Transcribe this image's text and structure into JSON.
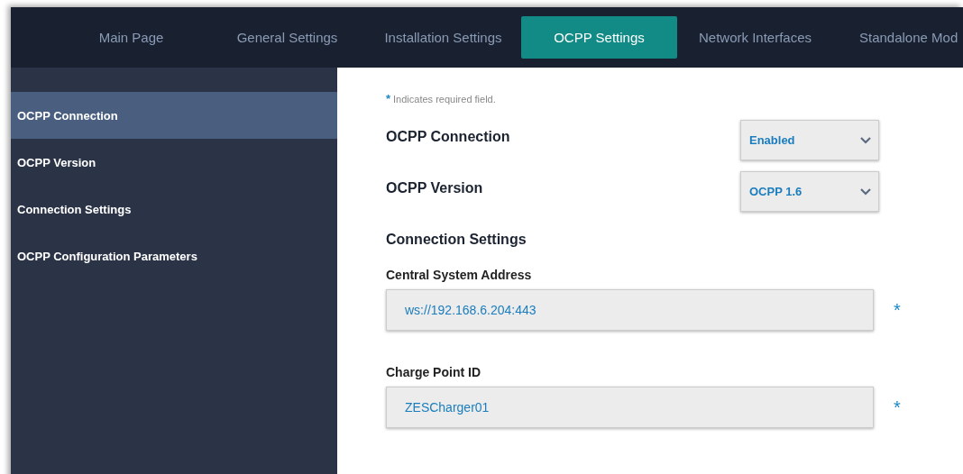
{
  "nav": {
    "tabs": [
      {
        "label": "Main Page",
        "selected": false
      },
      {
        "label": "General Settings",
        "selected": false
      },
      {
        "label": "Installation Settings",
        "selected": false
      },
      {
        "label": "OCPP Settings",
        "selected": true
      },
      {
        "label": "Network Interfaces",
        "selected": false
      },
      {
        "label": "Standalone Mod",
        "selected": false
      }
    ]
  },
  "sidebar": {
    "items": [
      {
        "label": "OCPP Connection",
        "selected": true
      },
      {
        "label": "OCPP Version",
        "selected": false
      },
      {
        "label": "Connection Settings",
        "selected": false
      },
      {
        "label": "OCPP Configuration Parameters",
        "selected": false
      }
    ]
  },
  "form": {
    "required_note": {
      "mark": "*",
      "text": "Indicates required field."
    },
    "fields": [
      {
        "kind": "select",
        "label": "OCPP Connection",
        "value": "Enabled"
      },
      {
        "kind": "select",
        "label": "OCPP Version",
        "value": "OCPP 1.6"
      },
      {
        "kind": "heading",
        "label": "Connection Settings"
      },
      {
        "kind": "text",
        "label": "Central System Address",
        "value": "ws://192.168.6.204:443",
        "mark": "*"
      },
      {
        "kind": "text",
        "label": "Charge Point ID",
        "value": "ZESCharger01",
        "mark": "*"
      }
    ]
  }
}
